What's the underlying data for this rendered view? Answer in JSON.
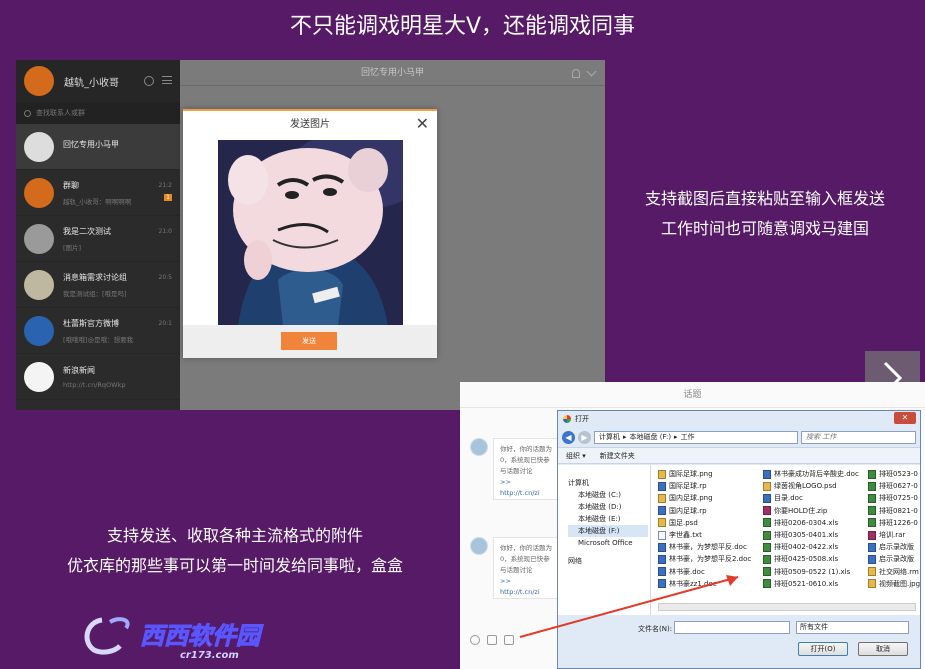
{
  "headline": "不只能调戏明星大V，还能调戏同事",
  "chat1": {
    "user_name": "越轨_小收哥",
    "search_placeholder": "查找联系人或群",
    "title": "回忆专用小马甲",
    "conversations": [
      {
        "name": "回忆专用小马甲",
        "sub": "",
        "time": "",
        "badge": ""
      },
      {
        "name": "群聊",
        "sub": "越轨_小收哥：啊啊啊啊",
        "time": "21:2",
        "badge": "1"
      },
      {
        "name": "我是二次测试",
        "sub": "[图片]",
        "time": "21:0",
        "badge": ""
      },
      {
        "name": "消息箱需求讨论组",
        "sub": "我是测试组：[哦是吗]",
        "time": "20:5",
        "badge": ""
      },
      {
        "name": "杜蕾斯官方微博",
        "sub": "[哦哦哦]@是哦：想要我",
        "time": "20:1",
        "badge": ""
      },
      {
        "name": "新浪新闻",
        "sub": "http://t.cn/RqOWkp",
        "time": "",
        "badge": ""
      }
    ],
    "dialog": {
      "title": "发送图片",
      "close": "✕",
      "send_label": "发送"
    }
  },
  "caption_right": [
    "支持截图后直接粘贴至输入框发送",
    "工作时间也可随意调戏马建国"
  ],
  "caption_left": [
    "支持发送、收取各种主流格式的附件",
    "优衣库的那些事可以第一时间发给同事啦，盒盒"
  ],
  "chat2": {
    "title": "话题",
    "messages": [
      {
        "text": "你好，你的话题为0，系统现已快参与话题讨论",
        "link": ">> http://t.cn/zi"
      },
      {
        "text": "你好，你的话题为0，系统现已快参与话题讨论",
        "link": ">> http://t.cn/zi"
      }
    ]
  },
  "file_dialog": {
    "title": "打开",
    "path": [
      "计算机",
      "本地磁盘 (F:)",
      "工作"
    ],
    "search_placeholder": "搜索 工作",
    "toolbar": [
      "组织 ▾",
      "新建文件夹"
    ],
    "tree": [
      "计算机",
      "本地磁盘 (C:)",
      "本地磁盘 (D:)",
      "本地磁盘 (E:)",
      "本地磁盘 (F:)",
      "Microsoft Office",
      "网络"
    ],
    "files_col1": [
      {
        "name": "国际足球.png",
        "type": "img"
      },
      {
        "name": "国际足球.rp",
        "type": "doc"
      },
      {
        "name": "国内足球.png",
        "type": "img"
      },
      {
        "name": "国内足球.rp",
        "type": "doc"
      },
      {
        "name": "国足.psd",
        "type": "img"
      },
      {
        "name": "李世鑫.txt",
        "type": "txt"
      },
      {
        "name": "林书豪，为梦想平反.doc",
        "type": "doc"
      },
      {
        "name": "林书豪，为梦想平反2.doc",
        "type": "doc"
      },
      {
        "name": "林书豪.doc",
        "type": "doc"
      },
      {
        "name": "林书豪zz1.doc",
        "type": "doc"
      }
    ],
    "files_col2": [
      {
        "name": "林书豪成功背后辛酸史.doc",
        "type": "doc"
      },
      {
        "name": "绿茵视角LOGO.psd",
        "type": "img"
      },
      {
        "name": "目录.doc",
        "type": "doc"
      },
      {
        "name": "你要HOLD住.zip",
        "type": "rar"
      },
      {
        "name": "排班0206-0304.xls",
        "type": "xls"
      },
      {
        "name": "排班0305-0401.xls",
        "type": "xls"
      },
      {
        "name": "排班0402-0422.xls",
        "type": "xls"
      },
      {
        "name": "排班0425-0508.xls",
        "type": "xls"
      },
      {
        "name": "排班0509-0522 (1).xls",
        "type": "xls"
      },
      {
        "name": "排班0521-0610.xls",
        "type": "xls"
      }
    ],
    "files_col3": [
      {
        "name": "排班0523-0",
        "type": "xls"
      },
      {
        "name": "排班0627-0",
        "type": "xls"
      },
      {
        "name": "排班0725-0",
        "type": "xls"
      },
      {
        "name": "排班0821-0",
        "type": "xls"
      },
      {
        "name": "排班1226-0",
        "type": "xls"
      },
      {
        "name": "培训.rar",
        "type": "rar"
      },
      {
        "name": "启示录改版",
        "type": "doc"
      },
      {
        "name": "启示录改版",
        "type": "doc"
      },
      {
        "name": "社交网络.rm",
        "type": "img"
      },
      {
        "name": "视频截图.jpg",
        "type": "img"
      }
    ],
    "filename_label": "文件名(N):",
    "filetype_value": "所有文件",
    "open_label": "打开(O)",
    "cancel_label": "取消"
  },
  "logo_text": "西西软件园",
  "logo_url": "cr173.com"
}
